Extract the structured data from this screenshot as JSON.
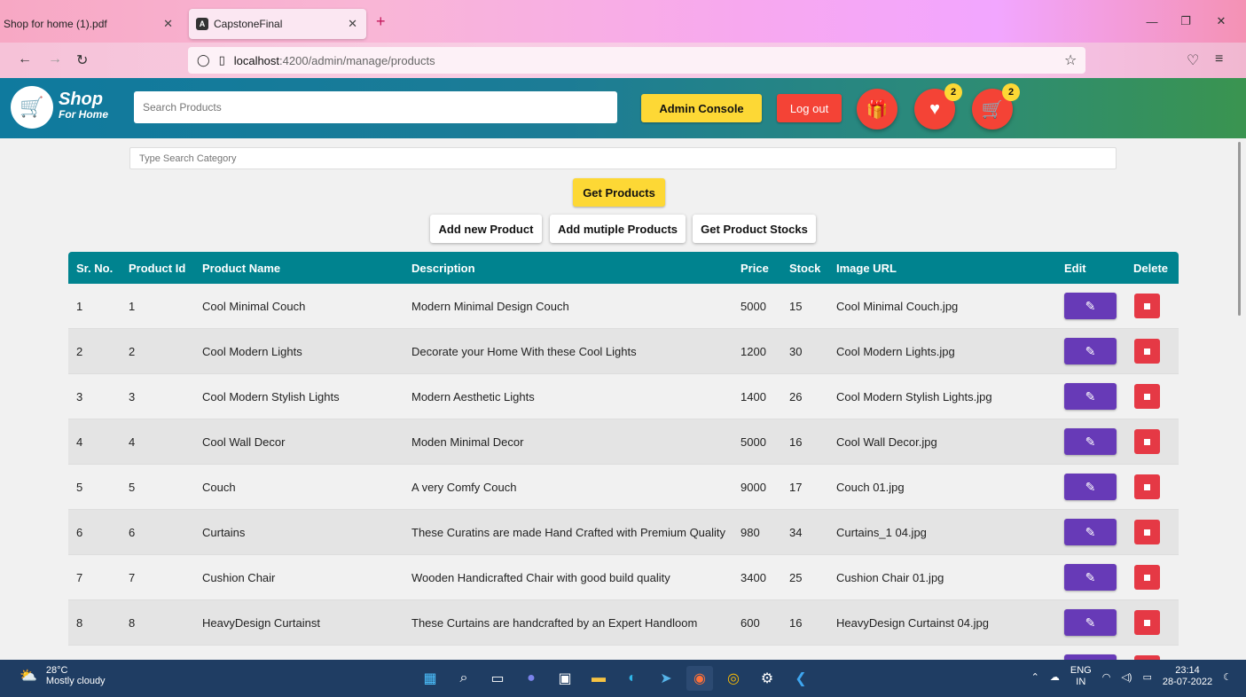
{
  "browser": {
    "tabs": [
      {
        "title": "Shop for home (1).pdf",
        "active": false
      },
      {
        "title": "CapstoneFinal",
        "active": true
      }
    ],
    "url_host": "localhost",
    "url_path": ":4200/admin/manage/products"
  },
  "header": {
    "logo_main": "Shop",
    "logo_sub": "For Home",
    "search_placeholder": "Search Products",
    "admin_console_label": "Admin Console",
    "logout_label": "Log out",
    "wishlist_count": "2",
    "cart_count": "2"
  },
  "controls": {
    "category_placeholder": "Type Search Category",
    "get_products_label": "Get Products",
    "add_new_label": "Add new Product",
    "add_multiple_label": "Add mutiple Products",
    "get_stocks_label": "Get Product Stocks"
  },
  "table": {
    "columns": [
      "Sr. No.",
      "Product Id",
      "Product Name",
      "Description",
      "Price",
      "Stock",
      "Image URL",
      "Edit",
      "Delete"
    ],
    "rows": [
      {
        "sr": "1",
        "id": "1",
        "name": "Cool Minimal Couch",
        "desc": "Modern Minimal Design Couch",
        "price": "5000",
        "stock": "15",
        "image": "Cool Minimal Couch.jpg"
      },
      {
        "sr": "2",
        "id": "2",
        "name": "Cool Modern Lights",
        "desc": "Decorate your Home With these Cool Lights",
        "price": "1200",
        "stock": "30",
        "image": "Cool Modern Lights.jpg"
      },
      {
        "sr": "3",
        "id": "3",
        "name": "Cool Modern Stylish Lights",
        "desc": "Modern Aesthetic Lights",
        "price": "1400",
        "stock": "26",
        "image": "Cool Modern Stylish Lights.jpg"
      },
      {
        "sr": "4",
        "id": "4",
        "name": "Cool Wall Decor",
        "desc": "Moden Minimal Decor",
        "price": "5000",
        "stock": "16",
        "image": "Cool Wall Decor.jpg"
      },
      {
        "sr": "5",
        "id": "5",
        "name": "Couch",
        "desc": "A very Comfy Couch",
        "price": "9000",
        "stock": "17",
        "image": "Couch 01.jpg"
      },
      {
        "sr": "6",
        "id": "6",
        "name": "Curtains",
        "desc": "These Curatins are made Hand Crafted with Premium Quality",
        "price": "980",
        "stock": "34",
        "image": "Curtains_1 04.jpg"
      },
      {
        "sr": "7",
        "id": "7",
        "name": "Cushion Chair",
        "desc": "Wooden Handicrafted Chair with good build quality",
        "price": "3400",
        "stock": "25",
        "image": "Cushion Chair 01.jpg"
      },
      {
        "sr": "8",
        "id": "8",
        "name": "HeavyDesign Curtainst",
        "desc": "These Curtains are handcrafted by an Expert Handloom",
        "price": "600",
        "stock": "16",
        "image": "HeavyDesign Curtainst 04.jpg"
      }
    ]
  },
  "taskbar": {
    "temperature": "28°C",
    "weather": "Mostly cloudy",
    "lang_1": "ENG",
    "lang_2": "IN",
    "time": "23:14",
    "date": "28-07-2022"
  },
  "colors": {
    "header_start": "#0f7a9e",
    "table_head": "#00838f",
    "edit": "#673ab7",
    "delete": "#e53945",
    "accent_yellow": "#fdd835",
    "accent_red": "#f44336"
  }
}
